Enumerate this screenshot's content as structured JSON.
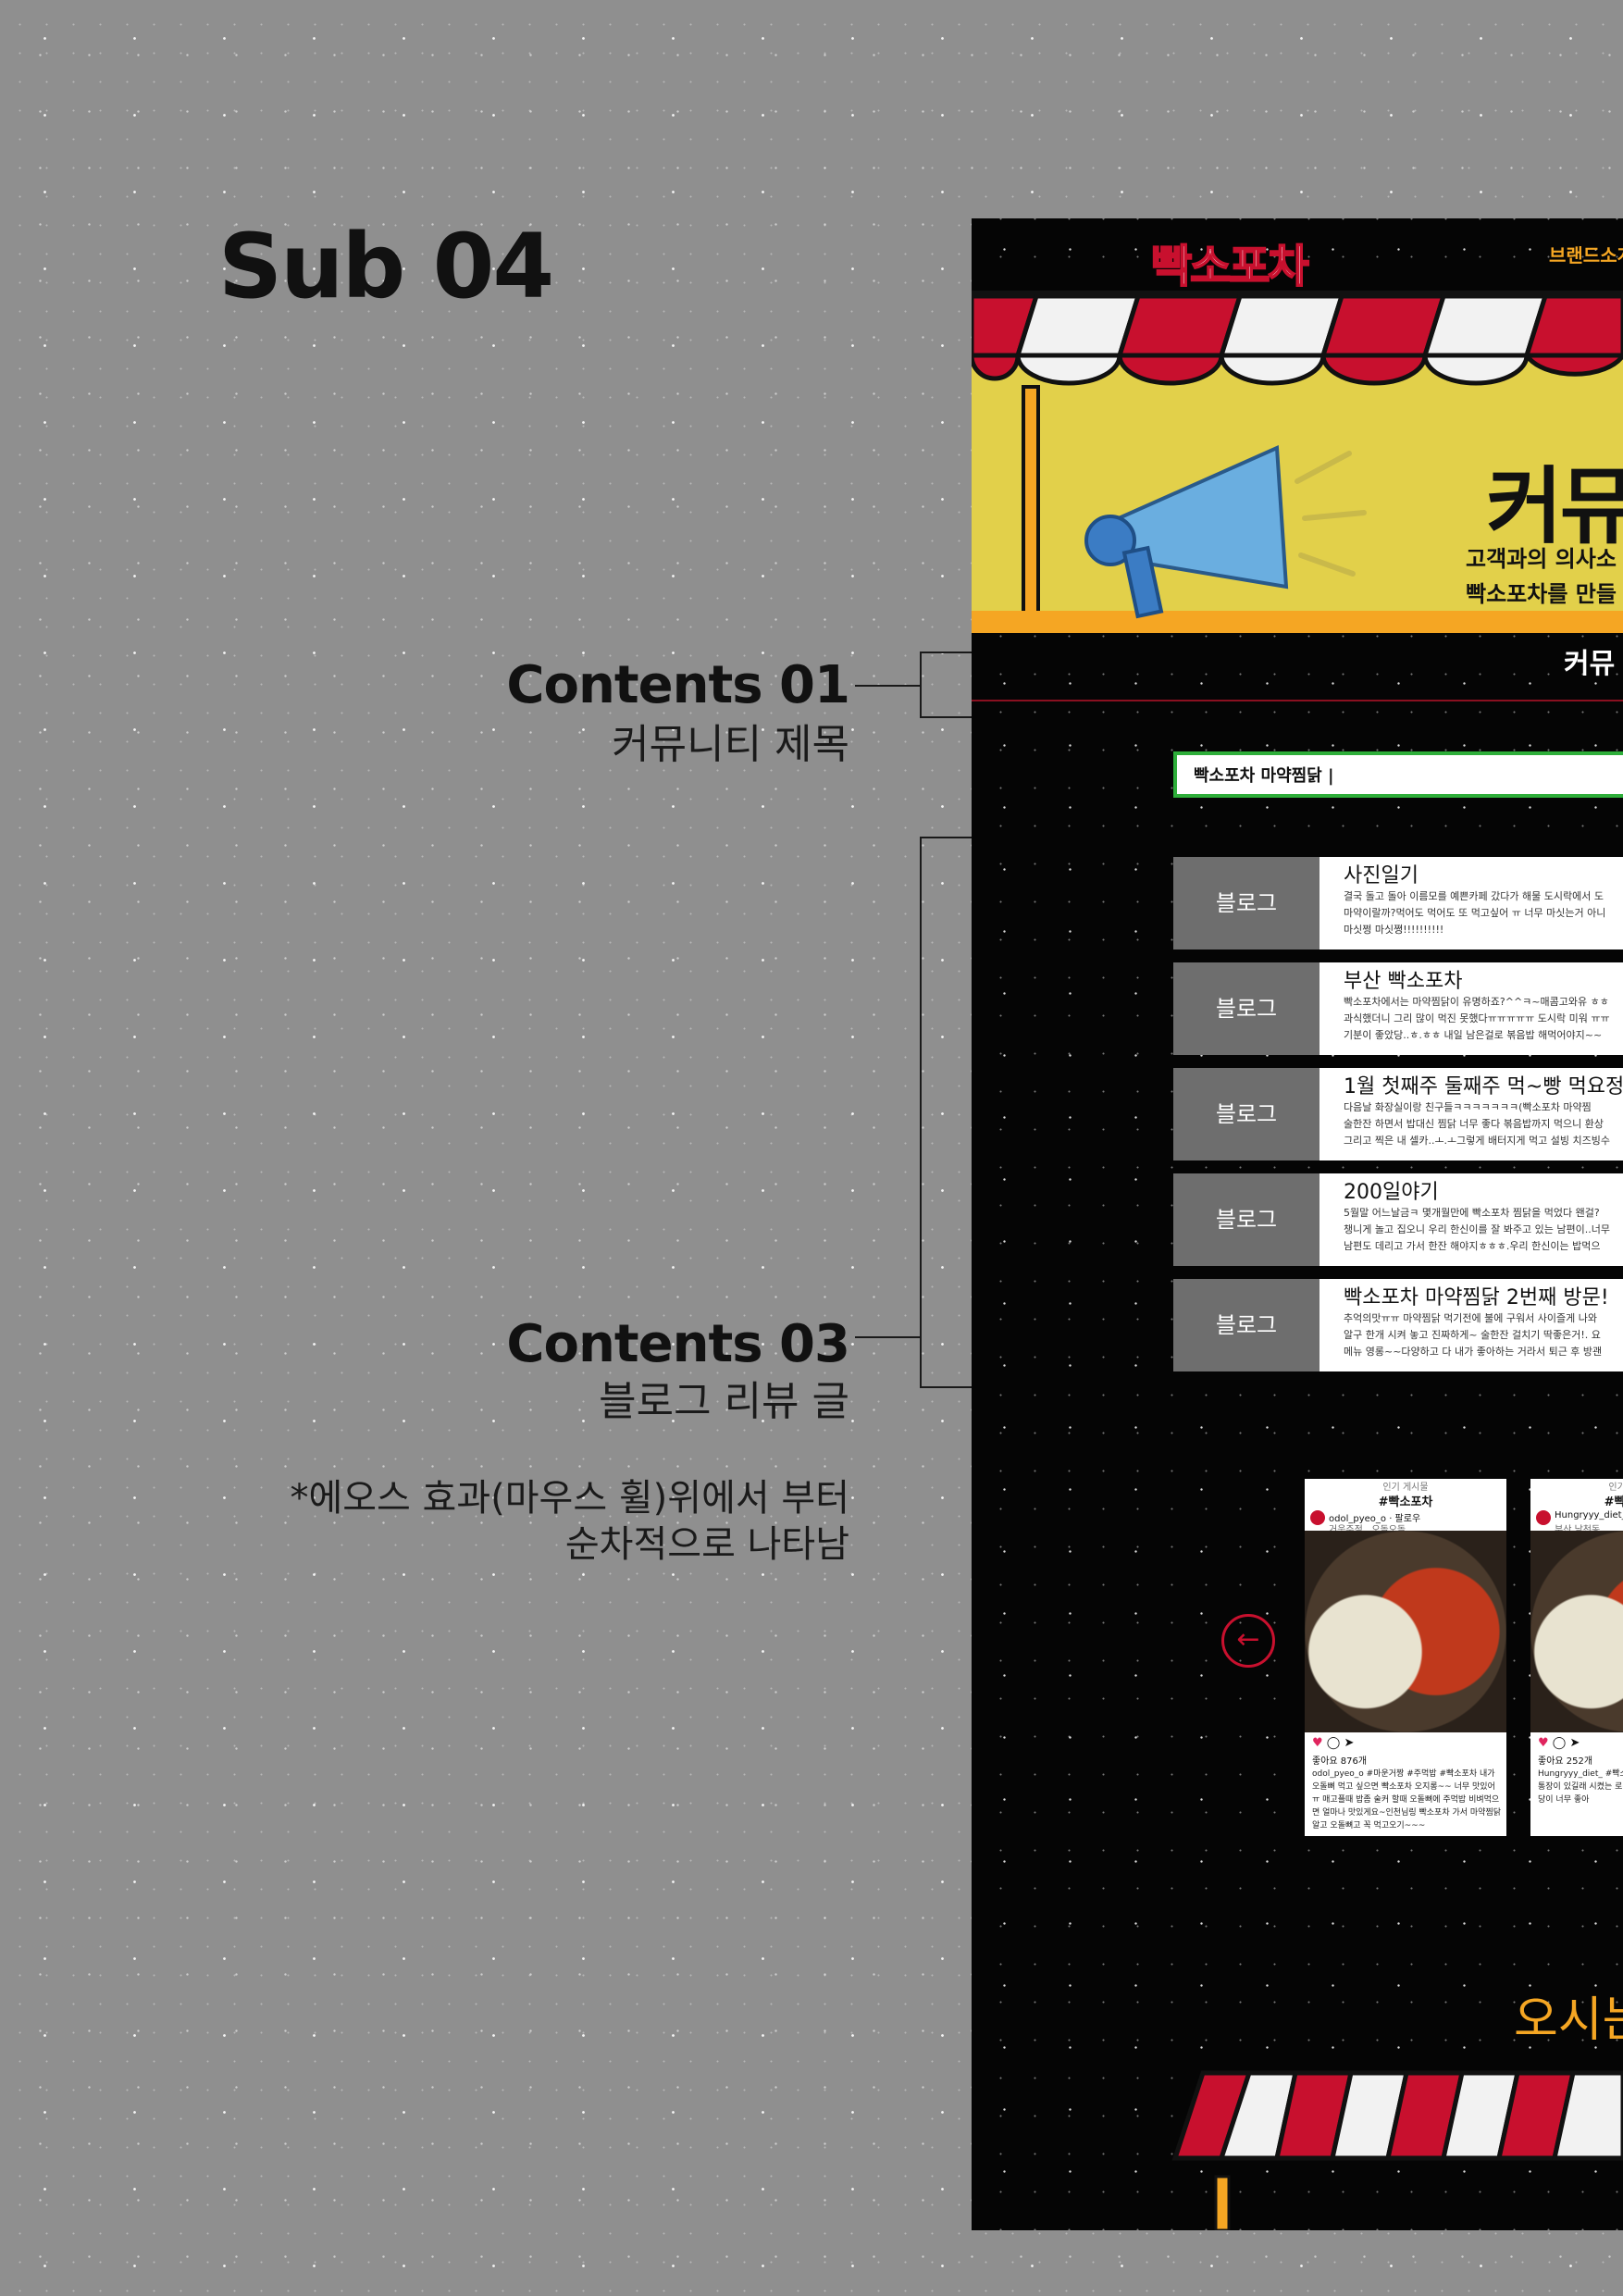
{
  "page_title": "Sub 04",
  "annotations": {
    "contents01": {
      "title": "Contents 01",
      "sub": "커뮤니티 제목"
    },
    "contents03": {
      "title": "Contents 03",
      "sub": "블로그 리뷰 글",
      "note_line1": "*에오스 효과(마우스 휠)위에서 부터",
      "note_line2": "순차적으로 나타남"
    }
  },
  "mockup": {
    "logo": "빡소포차",
    "nav_item": "브랜드소개",
    "hero_title": "커뮤",
    "hero_desc_line1": "고객과의 의사소",
    "hero_desc_line2": "빡소포차를 만들",
    "section_title": "커뮤",
    "search_value": "빡소포차 마약찜닭 |",
    "reviews": [
      {
        "badge": "블로그",
        "title": "사진일기",
        "lines": [
          "결국 돌고 돌아 이름모를 예쁜카페 갔다가 해물 도시락에서 도",
          "마약이랄까?먹어도 먹어도 또 먹고싶어 ㅠ 너무 마싯는거 아니",
          "마싯쩡 마싯쪙!!!!!!!!!!"
        ]
      },
      {
        "badge": "블로그",
        "title": "부산 빡소포차",
        "lines": [
          "빡소포차에서는 마약찜닭이 유명하죠?^^ㅋ~매콤고와유 ㅎㅎ",
          "과식했더니 그리 많이 먹진 못했다ㅠㅠㅠㅠㅠ 도시락 미워 ㅠㅠ",
          "기분이 좋았당..ㅎ.ㅎㅎ 내일 남은걸로 볶음밥 해먹어야지~~"
        ]
      },
      {
        "badge": "블로그",
        "title": "1월 첫째주 둘째주 먹~빵 먹요정",
        "lines": [
          "다음날 화장실이랑 친구들ㅋㅋㅋㅋㅋㅋㅋ(빡소포차 마약찜",
          "술한잔 하면서 밥대신 찜닭 너무 좋다 볶음밥까지 먹으니 환상",
          "그리고 찍은 내 셀카..ㅗ.ㅗ그렇게 배터지게 먹고 설빙 치즈빙수"
        ]
      },
      {
        "badge": "블로그",
        "title": "200일야기",
        "lines": [
          "5월말 어느날금ㅋ 몇개월만에 빡소포차 찜닭을 먹었다 왠걸?",
          "챙니게 놀고 집오니 우리 한신이를 잘 봐주고 있는 남편이..너무",
          "남편도 데리고 가서 한잔 해야지ㅎㅎㅎ.우리 한신이는 밥먹으"
        ]
      },
      {
        "badge": "블로그",
        "title": "빡소포차 마약찜닭 2번째 방문!",
        "lines": [
          "추억의맛ㅠㅠ 마약찜닭 먹기전에 불에 구워서 사이즐게 나와",
          "알구 한개 시켜 놓고 진짜하게~ 술한잔 걸치기 딱좋은거!. 요",
          "메뉴 영롱~~다양하고 다 내가 좋아하는 거라서 퇴근 후 방괜"
        ]
      }
    ],
    "carousel_arrow": "←",
    "posts": [
      {
        "header": "인기 게시물",
        "tag": "#빡소포차",
        "user": "odol_pyeo_o · 팔로우",
        "location": "거웃주점...오돌오돌",
        "likes": "좋아요 876개",
        "caption": "odol_pyeo_o #마운거짱 #주먹밥 #빡소포차 내가 오돌뼈 먹고 싶으면 빡소포차 오지롱~~ 너무 맛있어 ㅠ 매고플때 밥좀 술커 할때 오돌뼈에 주먹밥 비벼먹으면 얼마나 맛있게요~인천님링 빡소포차 가서 마약찜닭알고 오돌뼈고 꼭 먹고오기~~~"
      },
      {
        "header": "인기 게시물",
        "tag": "#빡소포차",
        "user": "Hungryyy_diet_",
        "location": "부산 남천동",
        "likes": "좋아요 252개",
        "caption": "Hungryyy_diet_ #빡소 퇴근하고 남자친구랑 한 데 통장이 있길래 시켰는 로션 매콤하여 맛있었고 식당 식당이 너무 좋아"
      }
    ],
    "footer_text": "오시는"
  },
  "colors": {
    "accent_red": "#c8102e",
    "accent_yellow": "#f5a623",
    "hero_yellow": "#e2d04a",
    "search_green": "#2eae3a"
  }
}
